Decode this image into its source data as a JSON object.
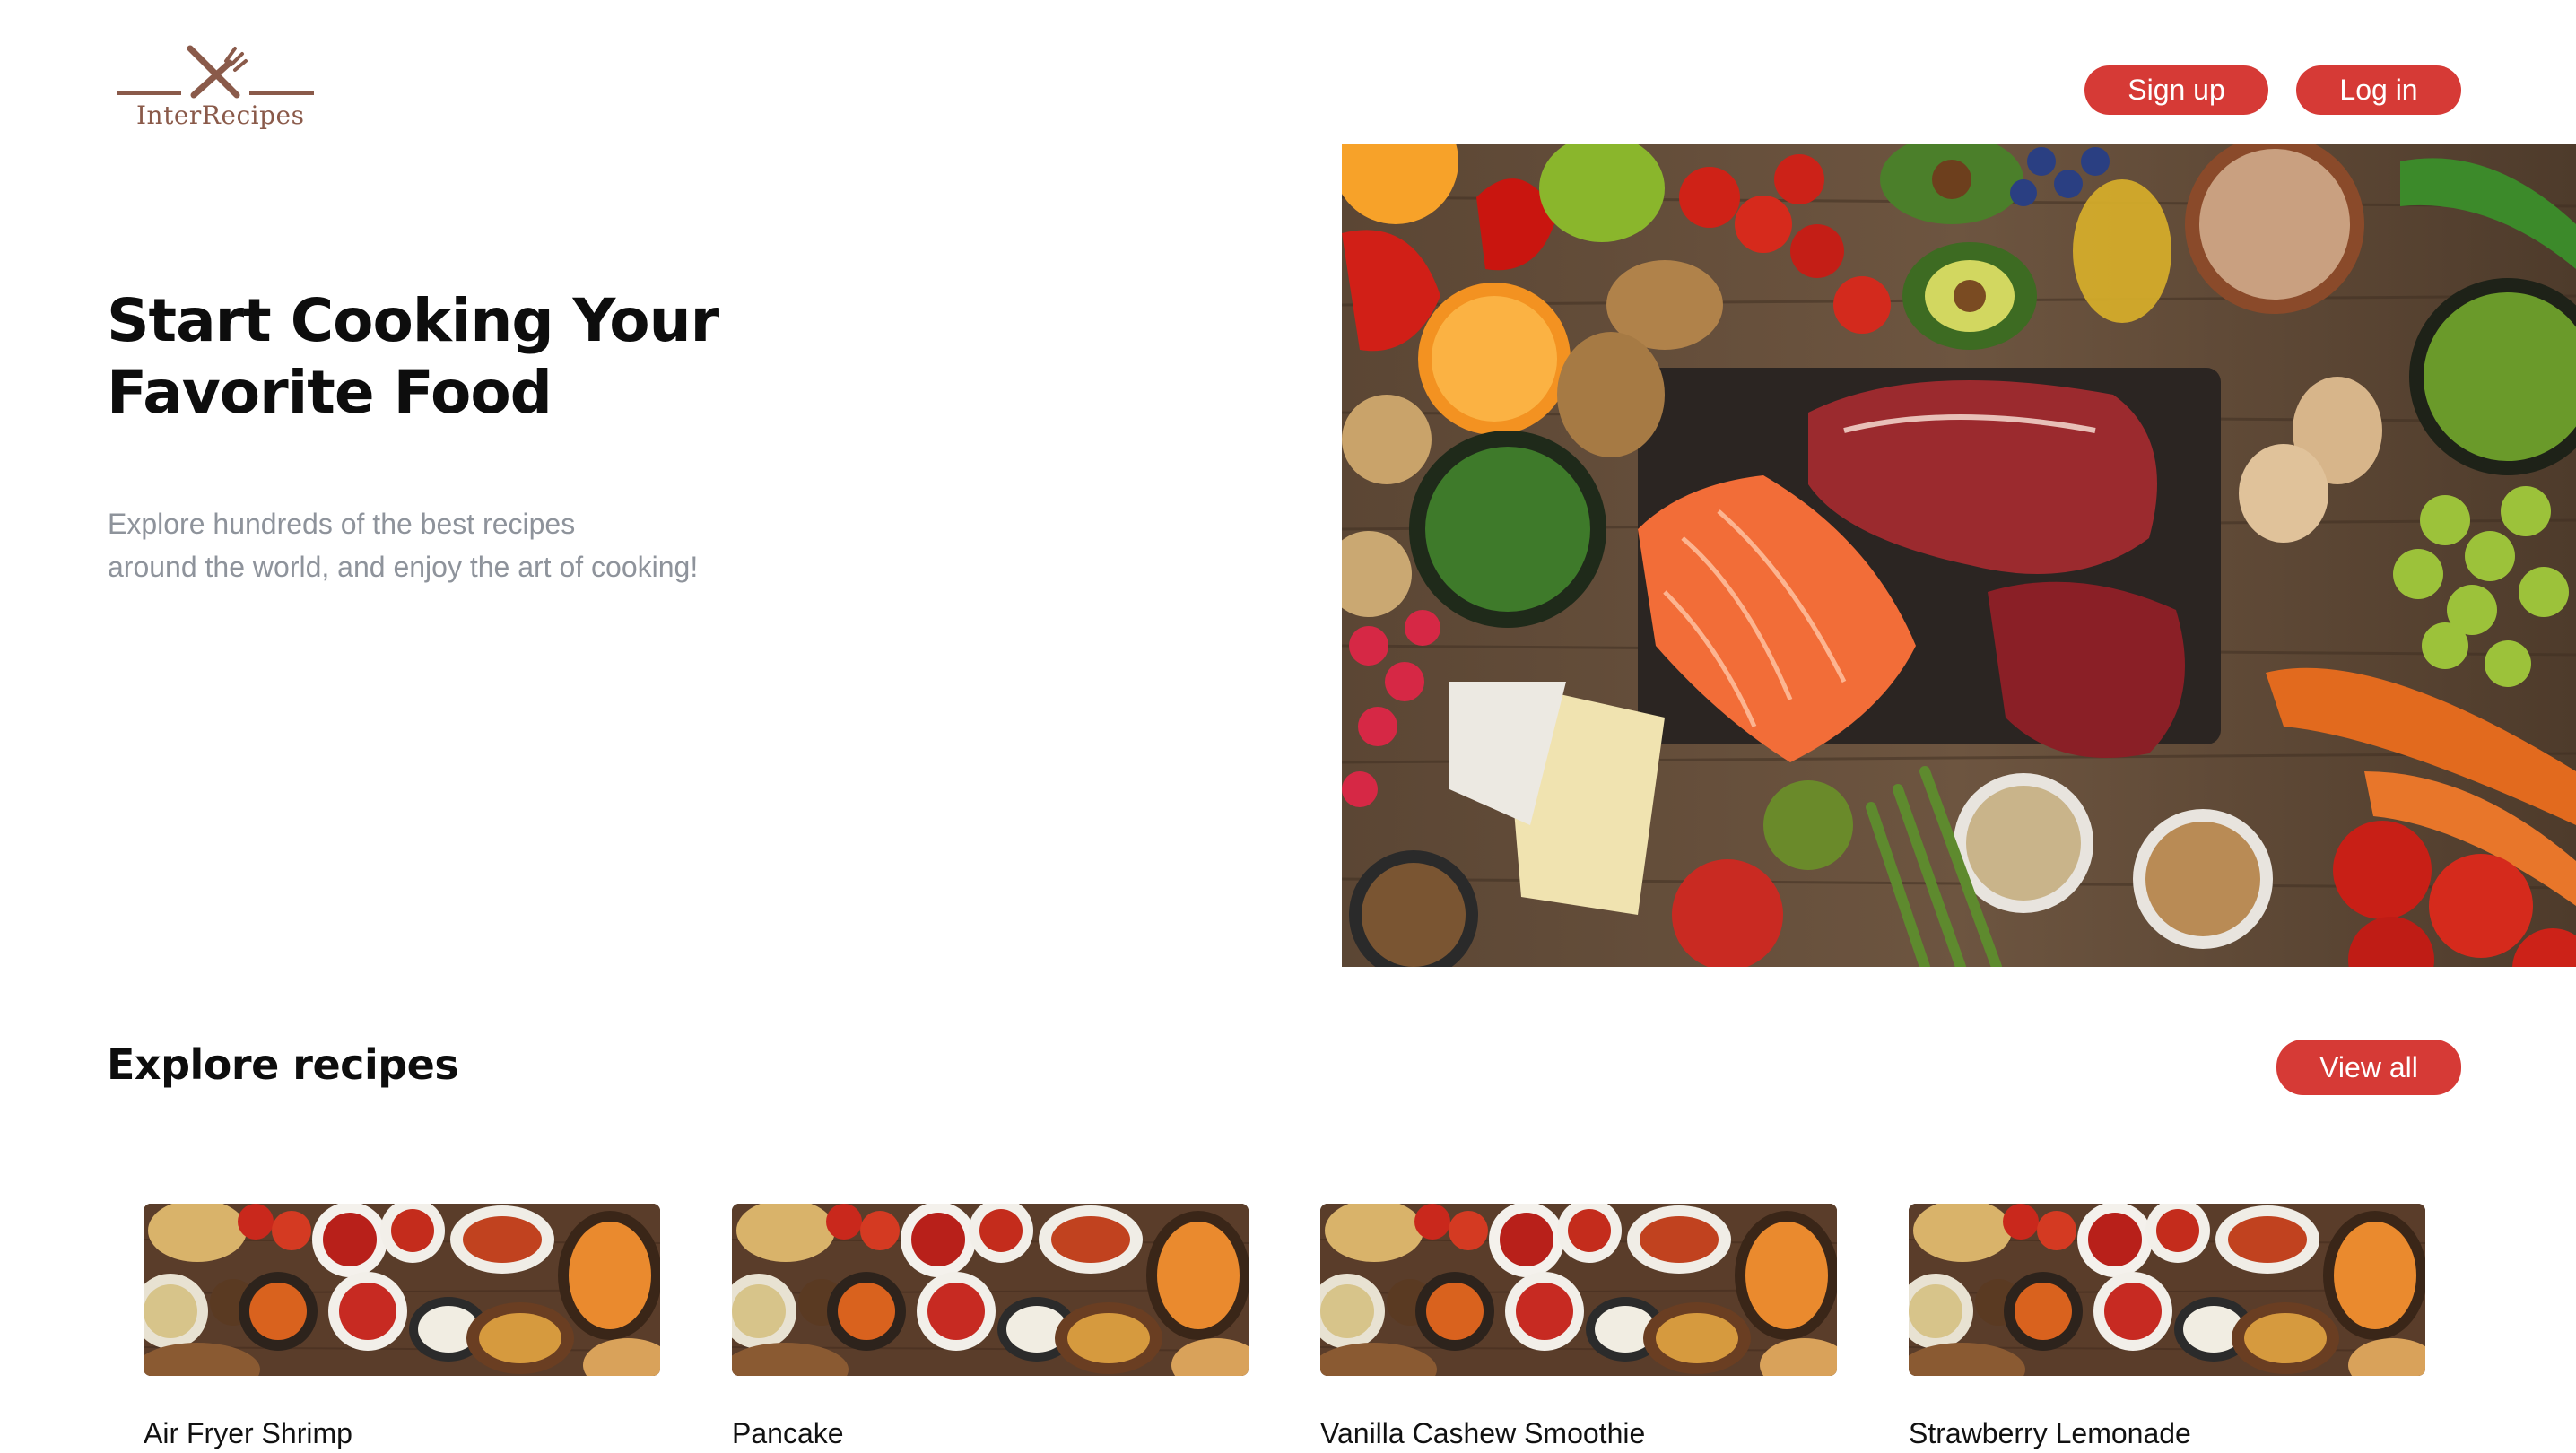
{
  "brand": {
    "name": "InterRecipes",
    "logo_icon": "crossed-fork-knife-icon",
    "logo_color": "#8a5a4a"
  },
  "header": {
    "signup_label": "Sign up",
    "login_label": "Log in",
    "accent_color": "#d63a36"
  },
  "hero": {
    "title": "Start Cooking Your Favorite Food",
    "subtitle_line1": "Explore hundreds of the best recipes",
    "subtitle_line2": "around the world, and enjoy the art of cooking!",
    "image": "assorted-fresh-ingredients-photo"
  },
  "explore": {
    "title": "Explore recipes",
    "view_all_label": "View all",
    "recipes": [
      {
        "title": "Air Fryer Shrimp",
        "image": "assorted-dishes-photo"
      },
      {
        "title": "Pancake",
        "image": "assorted-dishes-photo"
      },
      {
        "title": "Vanilla Cashew Smoothie",
        "image": "assorted-dishes-photo"
      },
      {
        "title": "Strawberry Lemonade",
        "image": "assorted-dishes-photo"
      }
    ]
  }
}
